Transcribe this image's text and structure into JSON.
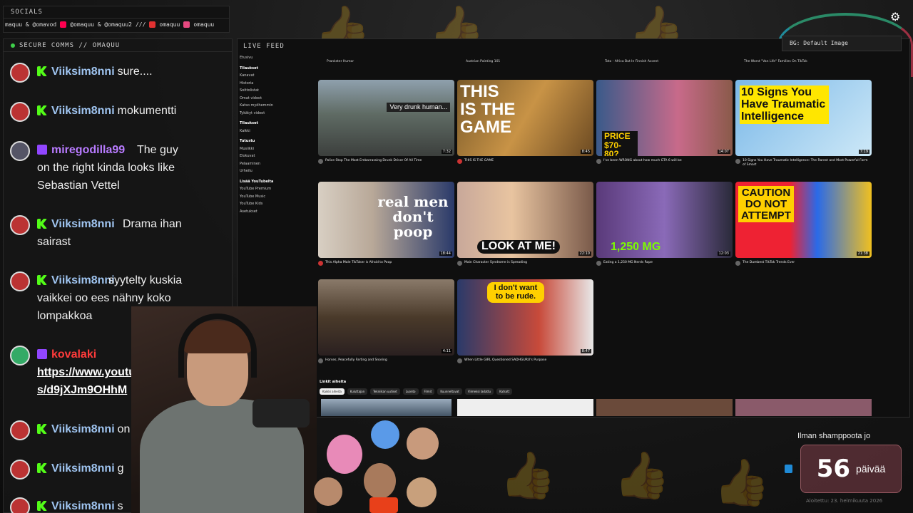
{
  "socials": {
    "title": "SOCIALS",
    "items": [
      "maquu & @omavod",
      "@omaquu & @omaquu2",
      "///",
      "omaquu",
      "omaquu"
    ]
  },
  "chat": {
    "header": "SECURE COMMS // OMAQUU",
    "messages": [
      {
        "platform": "kick",
        "user": "Viiksim8nni",
        "text": "sure...."
      },
      {
        "platform": "kick",
        "user": "Viiksim8nni",
        "text": "mokumentti"
      },
      {
        "platform": "twitch",
        "user": "miregodilla99",
        "text": "The guy on the right kinda looks like Sebastian Vettel"
      },
      {
        "platform": "kick",
        "user": "Viiksim8nni",
        "text": "Drama ihan sairast"
      },
      {
        "platform": "kick",
        "user": "Viiksim8nni",
        "text": "syytelty kuskia vaikkei oo ees nähny koko lompakkoa"
      },
      {
        "platform": "twitch",
        "user": "kovalaki",
        "text": "https://www.youtube.com/s rts/d9jXJm9OHhM"
      },
      {
        "platform": "kick",
        "user": "Viiksim8nni",
        "text": "on j"
      },
      {
        "platform": "kick",
        "user": "Viiksim8nni",
        "text": "g"
      },
      {
        "platform": "kick",
        "user": "Viiksim8nni",
        "text": "s"
      }
    ]
  },
  "feed": {
    "title": "LIVE FEED",
    "bg_label": "BG: Default Image",
    "sidebar": [
      "Etusivu",
      "Tilaukset",
      "Kanavat",
      "Historia",
      "Soittolistat",
      "Omat videot",
      "Katso myöhemmin",
      "Tykätyt videot",
      "Tilaukset",
      "Kaikki",
      "Tutustu",
      "Musiikki",
      "Elokuvat",
      "Pelaaminen",
      "Urheilu",
      "Lisää YouTubelta",
      "YouTube Premium",
      "YouTube Music",
      "YouTube Kids",
      "Asetukset"
    ],
    "top_row": [
      "Prankster Humor",
      "Austrian Painting 101",
      "Toto - Africa But In Finnish Accent",
      "The Worst \"Van Life\" Families On TikTok"
    ],
    "videos": [
      {
        "title": "Police Stop The Most Embarrassing Drunk Driver Of All Time",
        "thumb_text": "Very drunk human...",
        "duration": "7:32"
      },
      {
        "title": "THIS IS THE GAME",
        "thumb_text": "THIS IS THE GAME",
        "duration": "8:45"
      },
      {
        "title": "I've been WRONG about how much GTA 6 will be",
        "thumb_text": "PRICE $70-80?",
        "duration": "14:07"
      },
      {
        "title": "10 Signs You Have Traumatic Intelligence: The Rarest and Most Powerful Form of Smart",
        "thumb_text": "10 Signs You Have Traumatic Intelligence",
        "duration": "7:19"
      },
      {
        "title": "This Alpha Male TikToker is Afraid to Poop",
        "thumb_text": "real men don't poop",
        "duration": "18:44"
      },
      {
        "title": "Main Character Syndrome is Spreading",
        "thumb_text": "LOOK AT ME!",
        "duration": "22:10"
      },
      {
        "title": "Eating a 1,250 MG Nerds Rope",
        "thumb_text": "1,250 MG",
        "duration": "12:03"
      },
      {
        "title": "The Dumbest TikTok Trends Ever",
        "thumb_text": "CAUTION DO NOT ATTEMPT",
        "duration": "21:38"
      },
      {
        "title": "Horses, Peacefully Farting and Snoring",
        "thumb_text": "",
        "duration": "4:11"
      },
      {
        "title": "When Little GIRL Questioned SADHGURU's Purpose",
        "thumb_text": "I don't want to be rude.",
        "duration": "8:47"
      }
    ],
    "linked_title": "Linkit aiheita",
    "chips": [
      "Kaikki aiheita",
      "Kuluttajan",
      "Tekniikan uutiset",
      "Luonto",
      "Filmit",
      "Kuunneltavat",
      "Viimeksi ladattu",
      "Katsott"
    ]
  },
  "counter": {
    "label": "Ilman shamppoota jo",
    "number": "56",
    "unit": "päivää",
    "sub": "Aloitettu: 23. helmikuuta 2026"
  }
}
